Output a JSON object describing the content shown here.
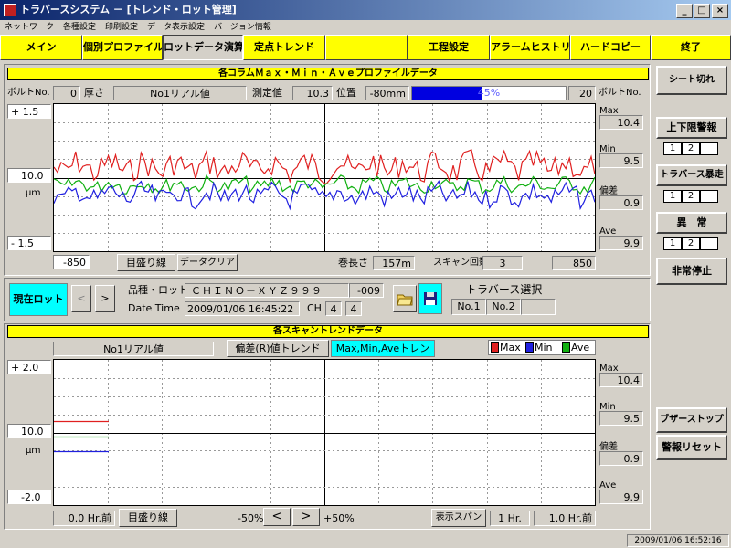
{
  "window": {
    "title": "トラバースシステム － [トレンド・ロット管理]"
  },
  "menu": [
    "ネットワーク",
    "各種設定",
    "印刷設定",
    "データ表示設定",
    "バージョン情報"
  ],
  "nav": [
    "メイン",
    "個別プロファイル",
    "ロットデータ演算",
    "定点トレンド",
    "",
    "工程設定",
    "アラームヒストリー",
    "ハードコピー",
    "終了"
  ],
  "profile": {
    "title": "各コラムＭａｘ・Ｍｉｎ・Ａｖｅプロファイルデータ",
    "bolt_label": "ボルトNo.",
    "bolt_left": "0",
    "thickness_label": "厚さ",
    "realtime_label": "No1リアル値",
    "measured_label": "測定値",
    "measured_value": "10.3",
    "position_label": "位置",
    "position_value": "-80mm",
    "progress_text": "45%",
    "progress": 0.45,
    "bolt_right": "20",
    "y_top": "+ 1.5",
    "y_center": "10.0",
    "y_unit": "μｍ",
    "y_bottom": "- 1.5",
    "x_left": "-850",
    "gridline_btn": "目盛り線",
    "clear_btn": "データクリア",
    "roll_length_label": "巻長さ",
    "roll_length_value": "157m",
    "scan_count_label": "スキャン回数",
    "scan_count_value": "3",
    "x_right": "850",
    "stats": {
      "max_label": "Max",
      "max": "10.4",
      "min_label": "Min",
      "min": "9.5",
      "dev_label": "偏差",
      "dev": "0.9",
      "ave_label": "Ave",
      "ave": "9.9"
    }
  },
  "lot": {
    "current_btn": "現在ロット",
    "prev_icon": "<",
    "next_icon": ">",
    "product_label": "品種・ロット",
    "product_value": "ＣＨＩＮＯ－ＸＹＺ９９９",
    "product_suffix": "-009",
    "datetime_label": "Date Time",
    "datetime_value": "2009/01/06 16:45:22",
    "ch_label": "CH",
    "ch_a": "4",
    "ch_b": "4",
    "traverse_label": "トラバース選択",
    "traverse_no1": "No.1",
    "traverse_no2": "No.2"
  },
  "trend": {
    "title": "各スキャントレンドデータ",
    "realtime_label": "No1リアル値",
    "dev_trend_btn": "偏差(R)値トレンド",
    "mma_trend_btn": "Max,Min,Aveトレンド",
    "legend": [
      {
        "name": "Max",
        "color": "#e02020"
      },
      {
        "name": "Min",
        "color": "#2020e0"
      },
      {
        "name": "Ave",
        "color": "#10b010"
      }
    ],
    "y_top": "+ 2.0",
    "y_center": "10.0",
    "y_unit": "μｍ",
    "y_bottom": "-2.0",
    "time_left": "0.0 Hr.前",
    "gridline_btn": "目盛り線",
    "zoom_minus": "-50%",
    "zoom_prev": "<",
    "zoom_next": ">",
    "zoom_plus": "+50%",
    "span_btn": "表示スパン",
    "span_value": "1 Hr.",
    "time_right": "1.0 Hr.前",
    "stats": {
      "max_label": "Max",
      "max": "10.4",
      "min_label": "Min",
      "min": "9.5",
      "dev_label": "偏差",
      "dev": "0.9",
      "ave_label": "Ave",
      "ave": "9.9"
    }
  },
  "right": {
    "sheet_cut": "シート切れ",
    "limit_alarm": "上下限警報",
    "traverse_runaway": "トラバース暴走",
    "abnormal": "異　常",
    "emergency_stop": "非常停止",
    "buzzer_stop": "ブザーストップ",
    "alarm_reset": "警報リセット",
    "cell1": "1",
    "cell2": "2"
  },
  "status": {
    "datetime": "2009/01/06 16:52:16"
  }
}
